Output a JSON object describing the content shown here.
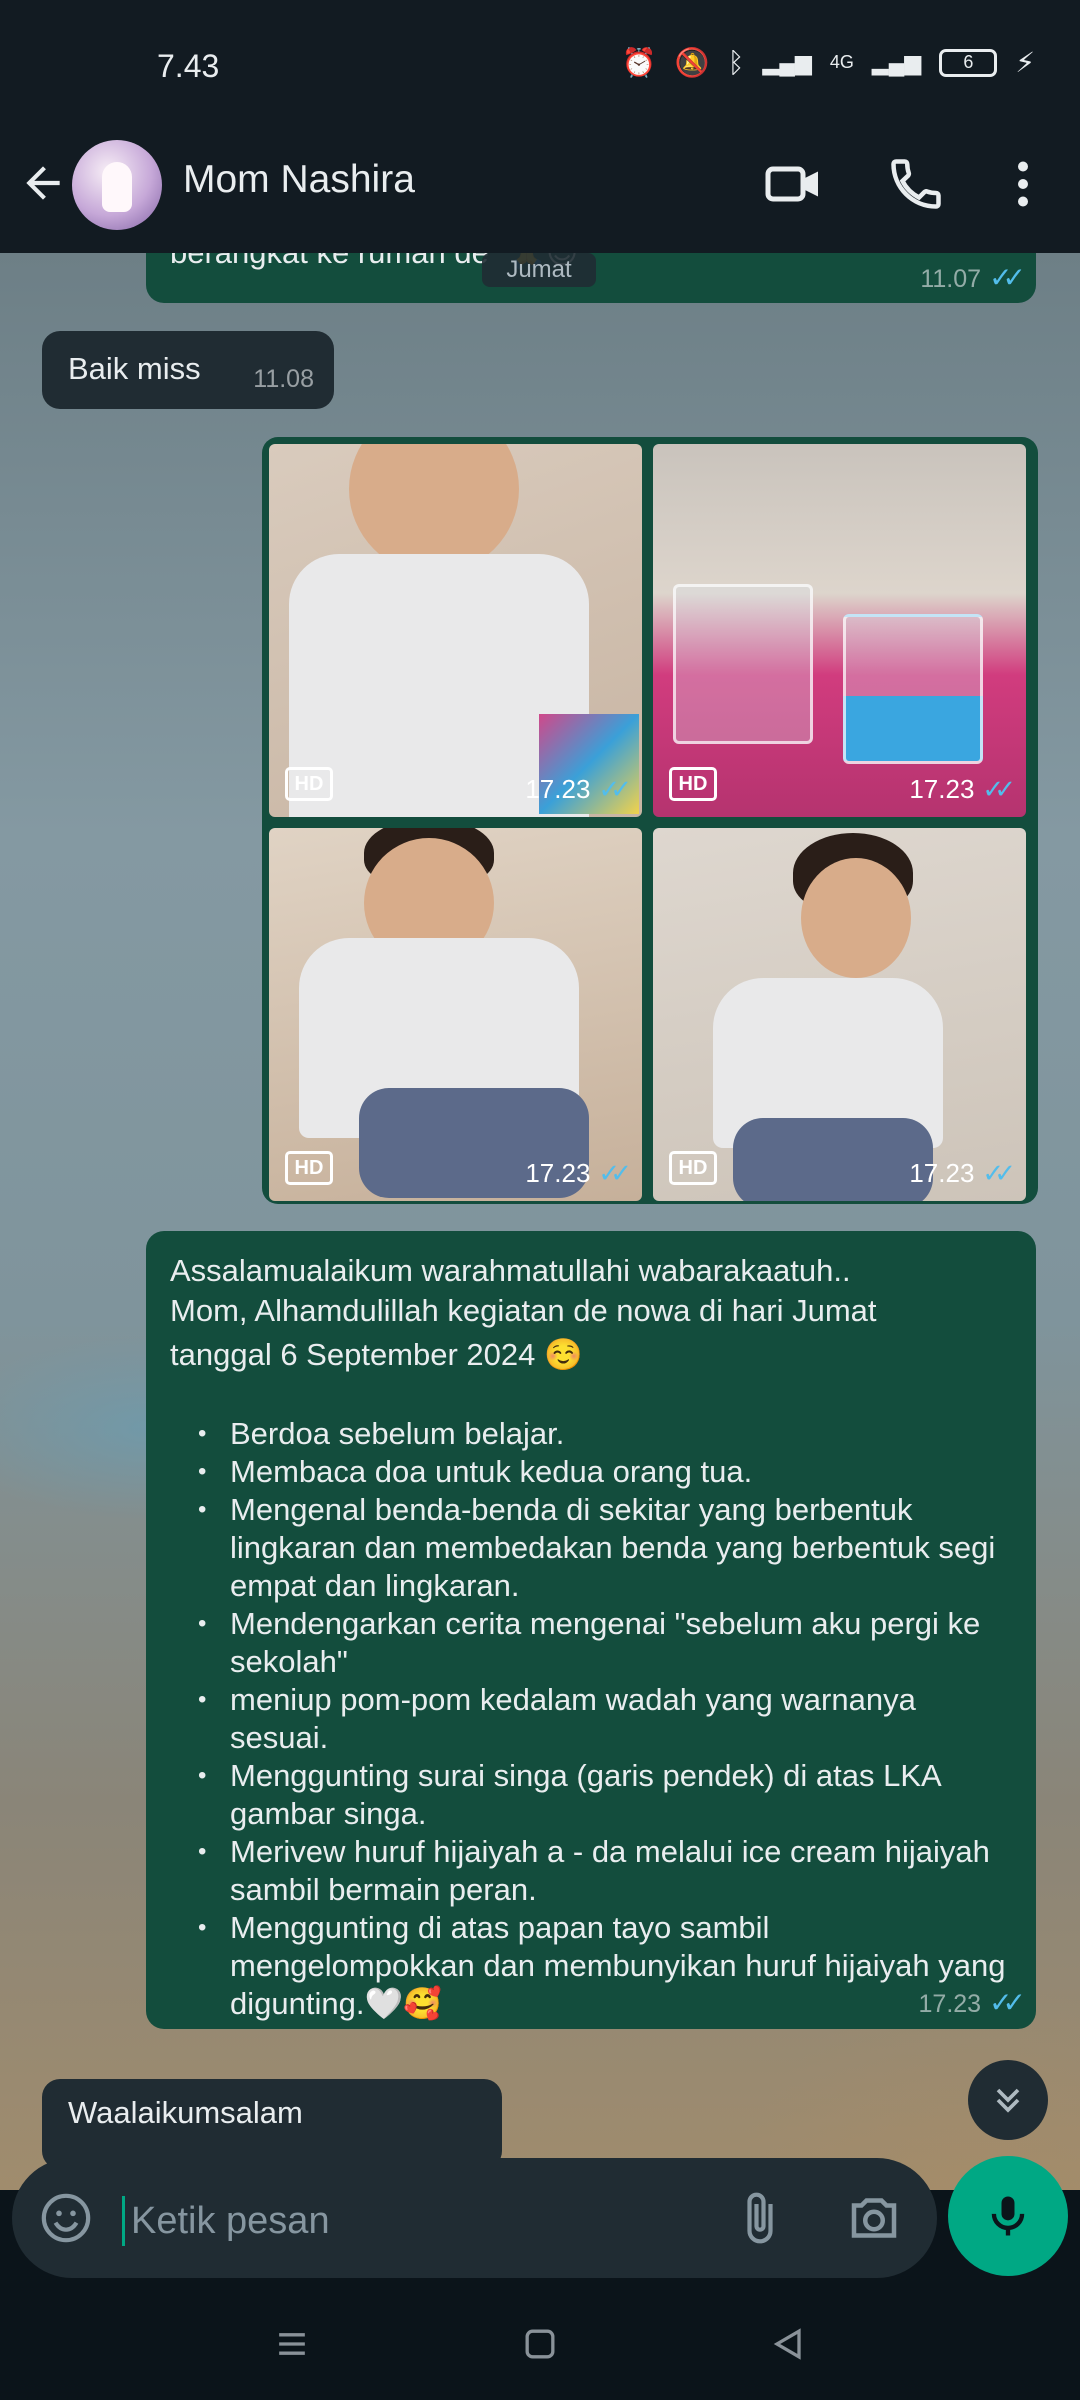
{
  "status_bar": {
    "time": "7.43",
    "battery": "6",
    "network": "4G"
  },
  "header": {
    "contact_name": "Mom Nashira"
  },
  "date_chip": "Jumat",
  "messages": {
    "m1": {
      "text": "berangkat ke rumah de",
      "emoji": "🙏😊",
      "time": "11.07"
    },
    "m2": {
      "text": "Baik miss",
      "time": "11.08"
    },
    "photos": [
      {
        "badge": "HD",
        "time": "17.23"
      },
      {
        "badge": "HD",
        "time": "17.23"
      },
      {
        "badge": "HD",
        "time": "17.23"
      },
      {
        "badge": "HD",
        "time": "17.23"
      }
    ],
    "m3": {
      "intro_1": "Assalamualaikum warahmatullahi wabarakaatuh..",
      "intro_2": "Mom, Alhamdulillah kegiatan de nowa di hari Jumat",
      "intro_3": "tanggal 6 September 2024 ☺️",
      "items": [
        "Berdoa sebelum belajar.",
        "Membaca doa untuk kedua orang tua.",
        "Mengenal benda-benda di sekitar yang berbentuk lingkaran dan membedakan benda yang berbentuk segi empat dan lingkaran.",
        "Mendengarkan cerita mengenai \"sebelum aku pergi ke sekolah\"",
        "meniup pom-pom kedalam wadah yang warnanya sesuai.",
        "Menggunting surai singa (garis pendek) di atas LKA gambar singa.",
        "Merivew huruf hijaiyah a - da melalui ice cream hijaiyah sambil bermain peran.",
        "Menggunting di atas papan tayo sambil mengelompokkan dan membunyikan huruf hijaiyah yang digunting.🤍🥰"
      ],
      "time": "17.23"
    },
    "m4": {
      "text": "Waalaikumsalam"
    }
  },
  "input": {
    "placeholder": "Ketik pesan"
  },
  "colors": {
    "outgoing": "#134d3d",
    "incoming": "#202c33",
    "accent": "#00a884",
    "ticks": "#53bdeb"
  }
}
